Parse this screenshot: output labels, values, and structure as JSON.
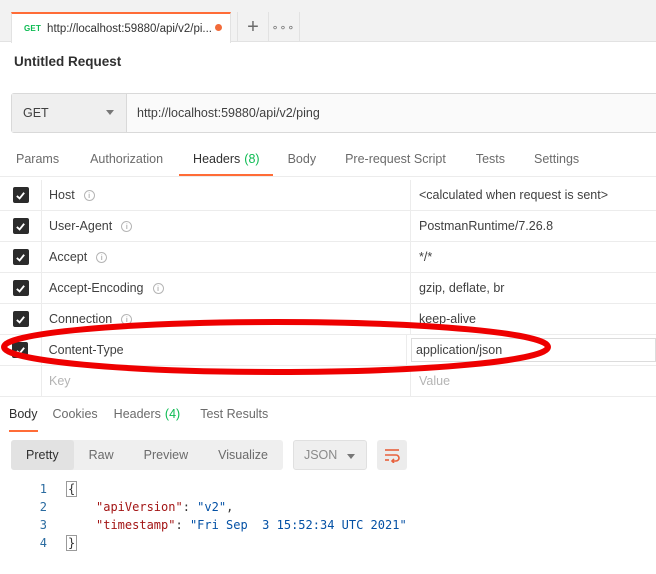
{
  "tab": {
    "method": "GET",
    "url_truncated": "http://localhost:59880/api/v2/pi...",
    "add_label": "+",
    "more_label": "∘∘∘"
  },
  "request_title": "Untitled Request",
  "url_bar": {
    "method": "GET",
    "url": "http://localhost:59880/api/v2/ping"
  },
  "request_tabs": [
    {
      "label": "Params"
    },
    {
      "label": "Authorization"
    },
    {
      "label": "Headers",
      "count": "(8)"
    },
    {
      "label": "Body"
    },
    {
      "label": "Pre-request Script"
    },
    {
      "label": "Tests"
    },
    {
      "label": "Settings"
    }
  ],
  "headers": [
    {
      "key": "Host",
      "value": "<calculated when request is sent>",
      "info": true
    },
    {
      "key": "User-Agent",
      "value": "PostmanRuntime/7.26.8",
      "info": true
    },
    {
      "key": "Accept",
      "value": "*/*",
      "info": true
    },
    {
      "key": "Accept-Encoding",
      "value": "gzip, deflate, br",
      "info": true
    },
    {
      "key": "Connection",
      "value": "keep-alive",
      "info": true
    },
    {
      "key": "Content-Type",
      "value": "application/json",
      "info": false
    }
  ],
  "new_row": {
    "key_placeholder": "Key",
    "value_placeholder": "Value"
  },
  "response_tabs": [
    {
      "label": "Body"
    },
    {
      "label": "Cookies"
    },
    {
      "label": "Headers",
      "count": "(4)"
    },
    {
      "label": "Test Results"
    }
  ],
  "view_modes": [
    "Pretty",
    "Raw",
    "Preview",
    "Visualize"
  ],
  "format": "JSON",
  "code_lines": [
    {
      "num": "1",
      "text": "{"
    },
    {
      "num": "2",
      "key": "\"apiVersion\"",
      "value": "\"v2\"",
      "trail": ","
    },
    {
      "num": "3",
      "key": "\"timestamp\"",
      "value": "\"Fri Sep  3 15:52:34 UTC 2021\"",
      "trail": ""
    },
    {
      "num": "4",
      "text": "}"
    }
  ],
  "colors": {
    "accent": "#ff6c37",
    "get_method": "#0cbb52",
    "annotation": "#ee0000",
    "json_key": "#a31515",
    "json_string": "#0451a5"
  }
}
